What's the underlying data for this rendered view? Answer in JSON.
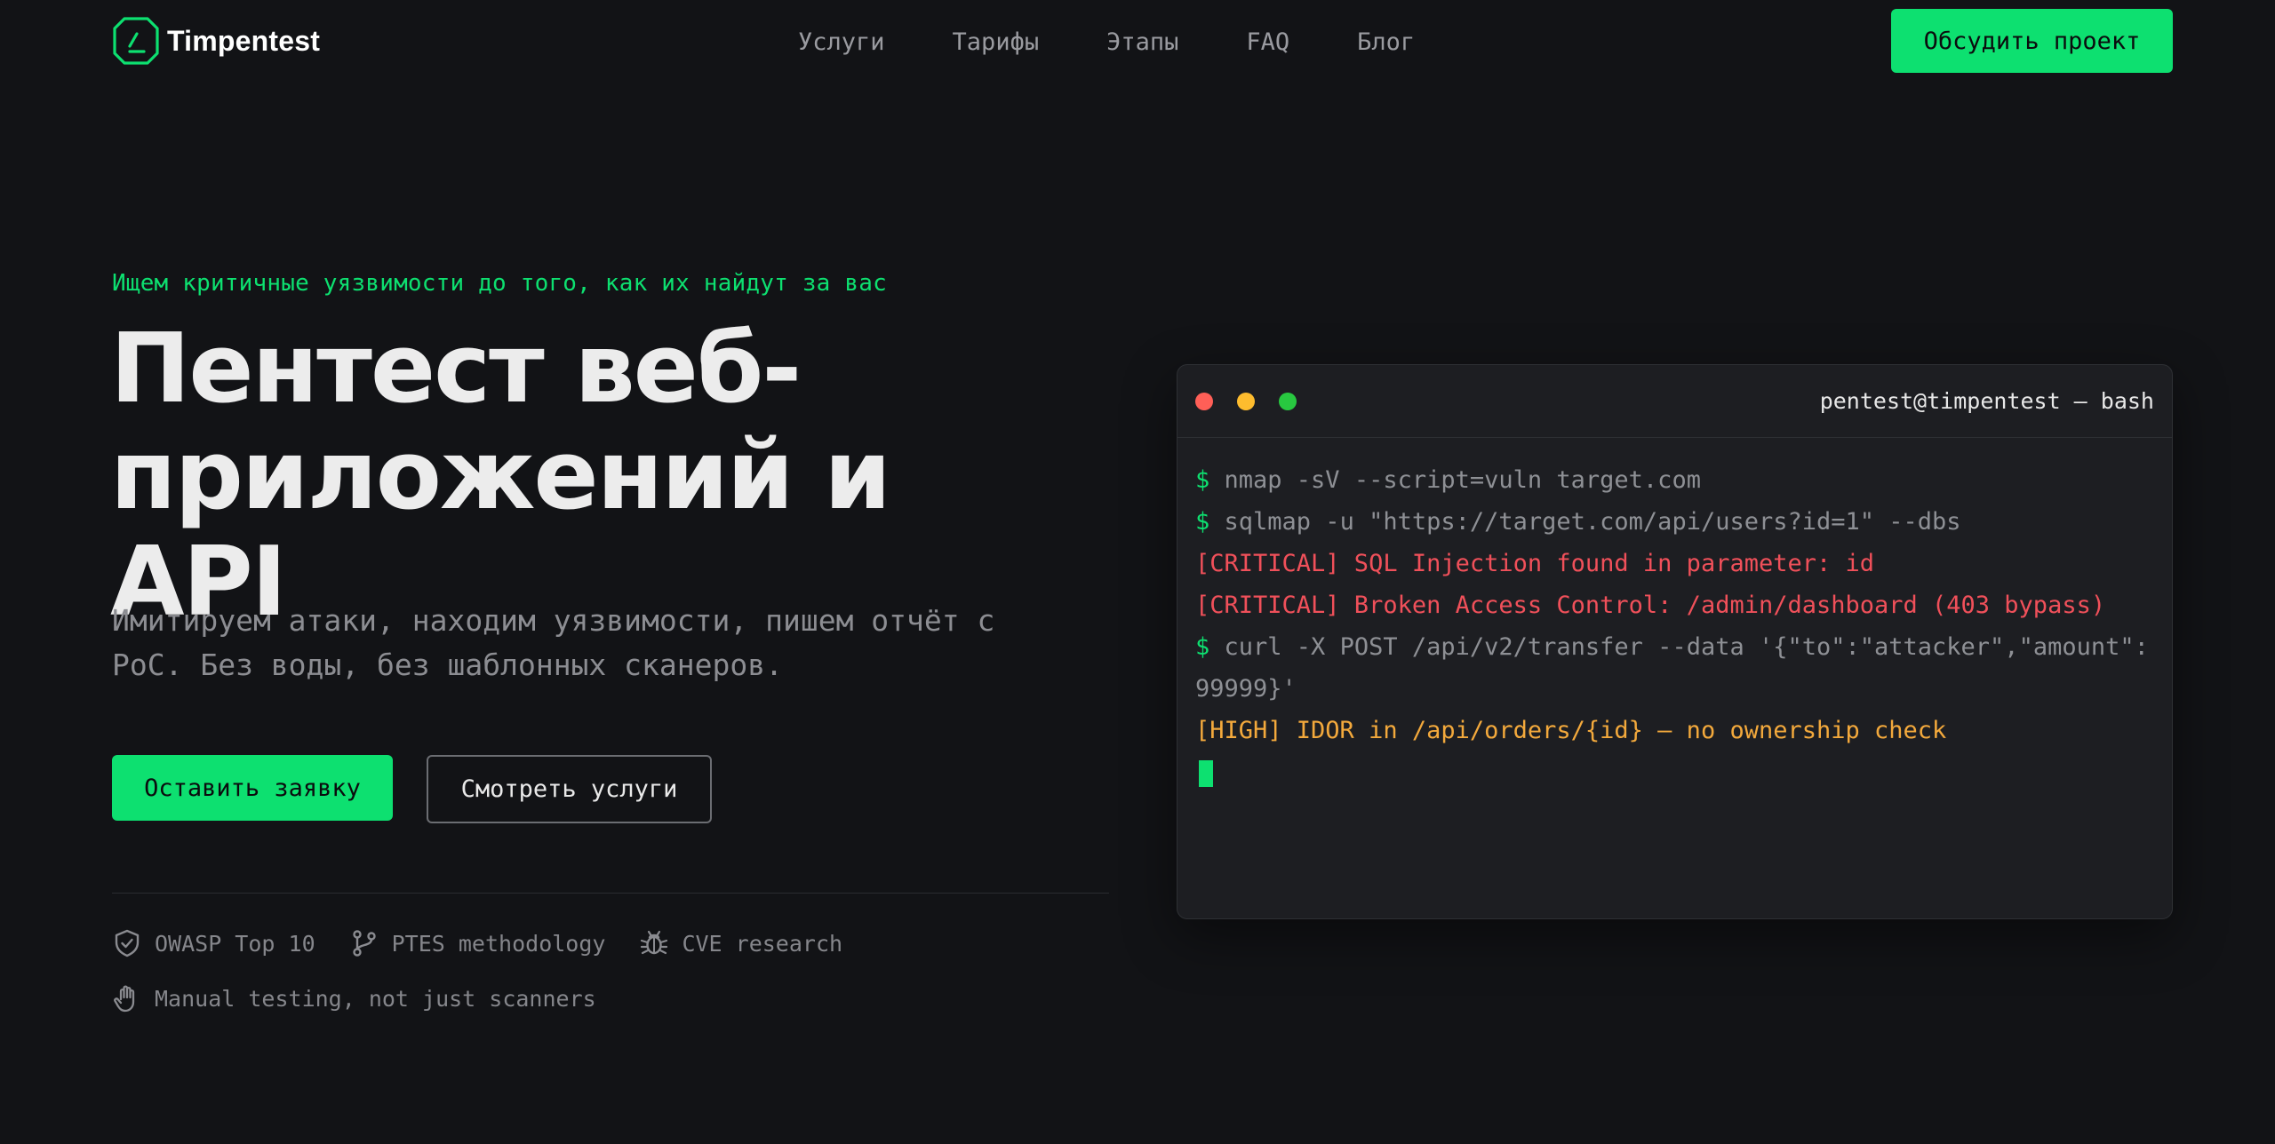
{
  "brand": {
    "name": "Timpentest",
    "logo_icon": "shield-check-logo-icon"
  },
  "colors": {
    "background": "#121316",
    "accent": "#0de070",
    "critical": "#f0505a",
    "high": "#f3a93c",
    "terminal_bg": "#1d1e22"
  },
  "nav": {
    "items": [
      {
        "label": "Услуги"
      },
      {
        "label": "Тарифы"
      },
      {
        "label": "Этапы"
      },
      {
        "label": "FAQ"
      },
      {
        "label": "Блог"
      }
    ]
  },
  "header": {
    "cta_label": "Обсудить проект"
  },
  "hero": {
    "eyebrow": "Ищем критичные уязвимости до того, как их найдут за вас",
    "title_line1": "Пентест веб-",
    "title_line2": "приложений и API",
    "subtitle": "Имитируем атаки, находим уязвимости, пишем отчёт с PoC. Без воды, без шаблонных сканеров.",
    "primary_button": "Оставить заявку",
    "secondary_button": "Смотреть услуги"
  },
  "badges": [
    {
      "icon": "shield-check-icon",
      "label": "OWASP Top 10"
    },
    {
      "icon": "git-branch-icon",
      "label": "PTES methodology"
    },
    {
      "icon": "bug-icon",
      "label": "CVE research"
    },
    {
      "icon": "hand-icon",
      "label": "Manual testing, not just scanners"
    }
  ],
  "terminal": {
    "title": "pentest@timpentest — bash",
    "window_dots": [
      "#ff5f57",
      "#febc2e",
      "#28c840"
    ],
    "prompt_symbol": "$",
    "lines": [
      {
        "type": "command",
        "text": " nmap -sV --script=vuln target.com"
      },
      {
        "type": "command",
        "text": " sqlmap -u \"https://target.com/api/users?id=1\" --dbs"
      },
      {
        "type": "critical",
        "text": "[CRITICAL] SQL Injection found in parameter: id"
      },
      {
        "type": "critical",
        "text": "[CRITICAL] Broken Access Control: /admin/dashboard (403 bypass)"
      },
      {
        "type": "command",
        "text": " curl -X POST /api/v2/transfer --data '{\"to\":\"attacker\",\"amount\":99999}'"
      },
      {
        "type": "high",
        "text": "[HIGH] IDOR in /api/orders/{id} — no ownership check"
      }
    ]
  }
}
